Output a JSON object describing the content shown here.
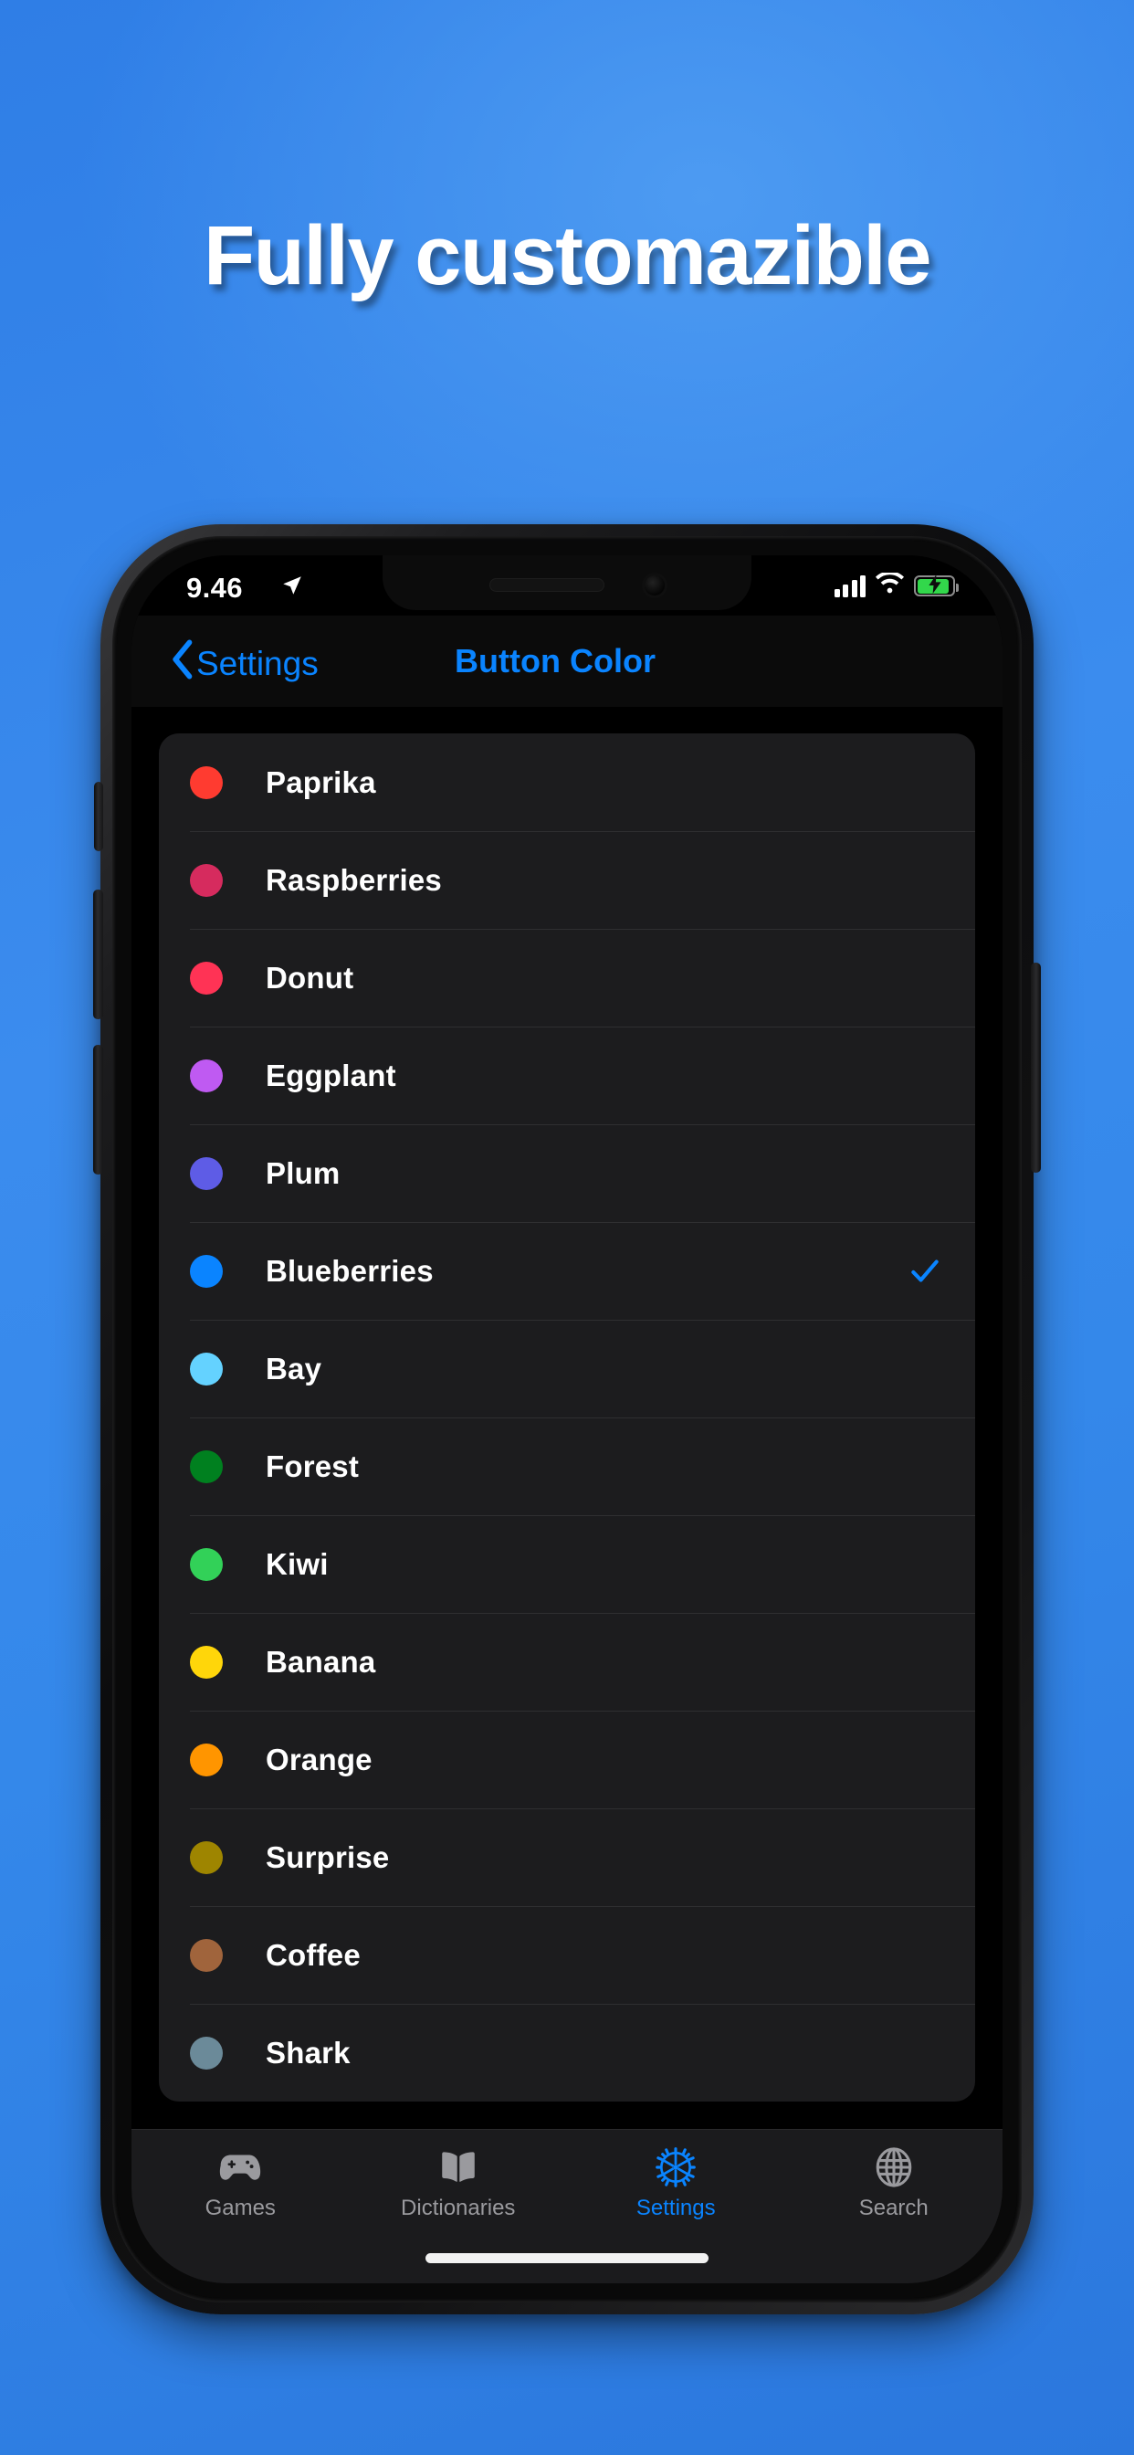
{
  "promo": {
    "headline": "Fully customazible",
    "background_top_color": "#3b8cee",
    "background_bottom_color": "#2b77dd"
  },
  "status_bar": {
    "time": "9.46",
    "location_icon": "location-arrow-icon",
    "signal_icon": "cellular-signal-icon",
    "wifi_icon": "wifi-icon",
    "battery_icon": "battery-charging-icon",
    "battery_color": "#32d74b"
  },
  "nav_bar": {
    "back_label": "Settings",
    "back_icon": "chevron-left-icon",
    "title": "Button Color",
    "tint_color": "#0a84ff"
  },
  "colors": {
    "selected": "Blueberries",
    "checkmark_color": "#0a84ff",
    "rows": [
      {
        "label": "Paprika",
        "swatch": "#ff3b30",
        "selected": false
      },
      {
        "label": "Raspberries",
        "swatch": "#d62b5e",
        "selected": false
      },
      {
        "label": "Donut",
        "swatch": "#ff3355",
        "selected": false
      },
      {
        "label": "Eggplant",
        "swatch": "#bf5af2",
        "selected": false
      },
      {
        "label": "Plum",
        "swatch": "#5e5ce6",
        "selected": false
      },
      {
        "label": "Blueberries",
        "swatch": "#0a84ff",
        "selected": true
      },
      {
        "label": "Bay",
        "swatch": "#64d2ff",
        "selected": false
      },
      {
        "label": "Forest",
        "swatch": "#00801f",
        "selected": false
      },
      {
        "label": "Kiwi",
        "swatch": "#32d158",
        "selected": false
      },
      {
        "label": "Banana",
        "swatch": "#ffd60a",
        "selected": false
      },
      {
        "label": "Orange",
        "swatch": "#ff9500",
        "selected": false
      },
      {
        "label": "Surprise",
        "swatch": "#9e8500",
        "selected": false
      },
      {
        "label": "Coffee",
        "swatch": "#a0643c",
        "selected": false
      },
      {
        "label": "Shark",
        "swatch": "#6b8a99",
        "selected": false
      }
    ]
  },
  "tab_bar": {
    "active": "Settings",
    "active_color": "#0a84ff",
    "inactive_color": "#9a9a9e",
    "items": [
      {
        "label": "Games",
        "icon": "gamepad-icon",
        "active": false
      },
      {
        "label": "Dictionaries",
        "icon": "book-icon",
        "active": false
      },
      {
        "label": "Settings",
        "icon": "gear-icon",
        "active": true
      },
      {
        "label": "Search",
        "icon": "globe-icon",
        "active": false
      }
    ]
  }
}
